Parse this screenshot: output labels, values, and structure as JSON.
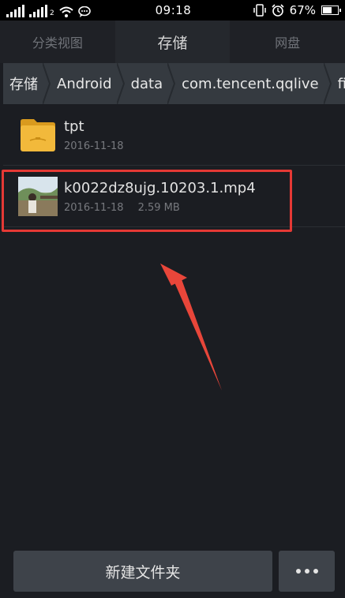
{
  "status_bar": {
    "network_sub": "2",
    "time": "09:18",
    "battery_percent": "67%",
    "battery_level": 0.67,
    "icons": [
      "signal-icon",
      "signal-icon",
      "wifi-icon",
      "message-icon",
      "vibrate-icon",
      "alarm-icon",
      "battery-icon"
    ]
  },
  "tabs": [
    {
      "label": "分类视图",
      "active": false
    },
    {
      "label": "存储",
      "active": true
    },
    {
      "label": "网盘",
      "active": false
    }
  ],
  "breadcrumb": [
    "存储",
    "Android",
    "data",
    "com.tencent.qqlive",
    "files"
  ],
  "files": [
    {
      "name": "tpt",
      "date": "2016-11-18",
      "size": "",
      "type": "folder"
    },
    {
      "name": "k0022dz8ujg.10203.1.mp4",
      "date": "2016-11-18",
      "size": "2.59 MB",
      "type": "video"
    }
  ],
  "bottom_bar": {
    "new_folder_label": "新建文件夹",
    "more_icon": "more-icon"
  },
  "colors": {
    "background": "#1b1d22",
    "highlight": "#e53935",
    "folder": "#f2b93b",
    "breadcrumb": "#353a40"
  }
}
